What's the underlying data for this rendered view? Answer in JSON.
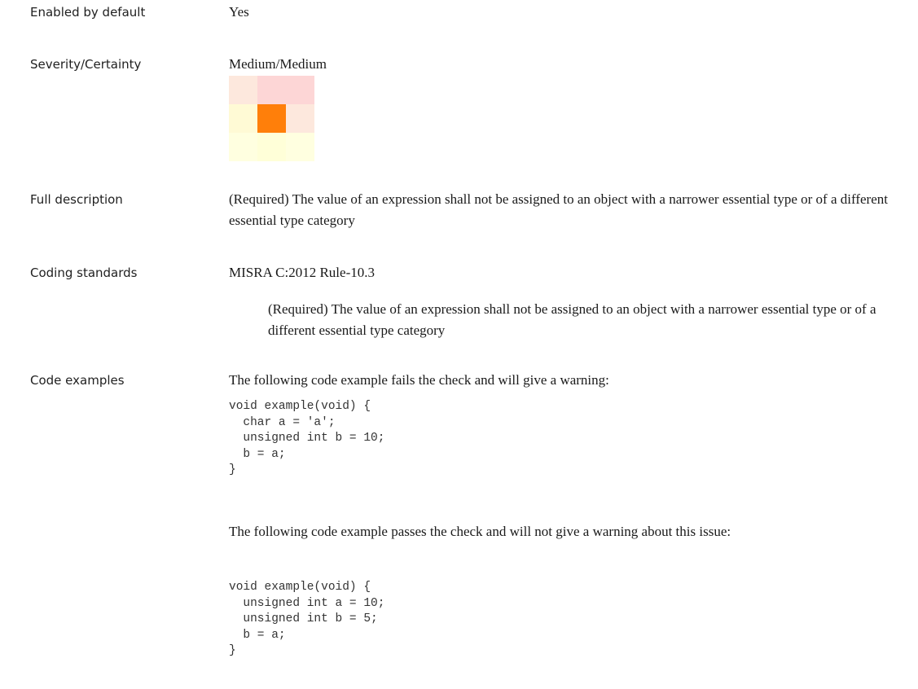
{
  "rows": {
    "enabled": {
      "label": "Enabled by default",
      "value": "Yes"
    },
    "severity": {
      "label": "Severity/Certainty",
      "value": "Medium/Medium",
      "matrix_colors": [
        [
          "#fde8dd",
          "#fdd6d6",
          "#fdd6d6"
        ],
        [
          "#fffad5",
          "#ff7f0a",
          "#fde8dd"
        ],
        [
          "#ffffe0",
          "#ffffd8",
          "#ffffe0"
        ]
      ]
    },
    "full_description": {
      "label": "Full description",
      "value": "(Required) The value of an expression shall not be assigned to an object with a narrower essential type or of a different essential type category"
    },
    "coding_standards": {
      "label": "Coding standards",
      "value": "MISRA C:2012 Rule-10.3",
      "detail": "(Required) The value of an expression shall not be assigned to an object with a narrower essential type or of a different essential type category"
    },
    "code_examples": {
      "label": "Code examples",
      "fail_intro": "The following code example fails the check and will give a warning:",
      "fail_code": "void example(void) {\n  char a = 'a';\n  unsigned int b = 10;\n  b = a;\n}",
      "pass_intro": "The following code example passes the check and will not give a warning about this issue:",
      "pass_code": "void example(void) {\n  unsigned int a = 10;\n  unsigned int b = 5;\n  b = a;\n}"
    }
  }
}
